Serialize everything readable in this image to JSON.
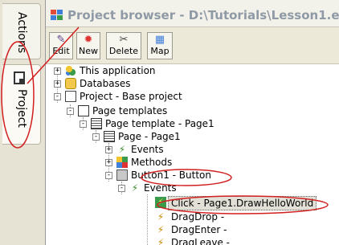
{
  "sidebar": {
    "tabs": [
      {
        "label": "Actions",
        "icon": ""
      },
      {
        "label": "Project",
        "icon": "page-icon"
      }
    ]
  },
  "window": {
    "title": "Project browser - D:\\Tutorials\\Lesson1.ezp",
    "icon": "project-browser-icon"
  },
  "toolbar": {
    "buttons": [
      {
        "label": "Edit",
        "icon": "edit-icon"
      },
      {
        "label": "New",
        "icon": "new-icon"
      },
      {
        "label": "Delete",
        "icon": "delete-icon"
      },
      {
        "label": "Map",
        "icon": "map-icon"
      }
    ]
  },
  "tree": {
    "nodes": [
      {
        "label": "This application",
        "icon": "application-icon",
        "expander": "+"
      },
      {
        "label": "Databases",
        "icon": "database-icon",
        "expander": "+"
      },
      {
        "label": "Project - Base project",
        "icon": "project-icon",
        "expander": "-"
      },
      {
        "label": "Page templates",
        "icon": "page-templates-icon",
        "expander": "-"
      },
      {
        "label": "Page template - Page1",
        "icon": "page-template-icon",
        "expander": "-"
      },
      {
        "label": "Page - Page1",
        "icon": "page-icon",
        "expander": "-"
      },
      {
        "label": "Events",
        "icon": "events-icon",
        "expander": "+"
      },
      {
        "label": "Methods",
        "icon": "methods-icon",
        "expander": "+"
      },
      {
        "label": "Button1 - Button",
        "icon": "button-icon",
        "expander": "-"
      },
      {
        "label": "Events",
        "icon": "events-icon",
        "expander": "-"
      },
      {
        "label": "Click - Page1.DrawHelloWorld",
        "icon": "click-event-icon",
        "expander": ""
      },
      {
        "label": "DragDrop -",
        "icon": "event-bolt-icon",
        "expander": ""
      },
      {
        "label": "DragEnter -",
        "icon": "event-bolt-icon",
        "expander": ""
      },
      {
        "label": "DragLeave -",
        "icon": "event-bolt-icon",
        "expander": ""
      }
    ]
  },
  "colors": {
    "annotation": "#d21f1f",
    "title_text": "#8f9aa6",
    "selection": "#e2e0d6"
  }
}
